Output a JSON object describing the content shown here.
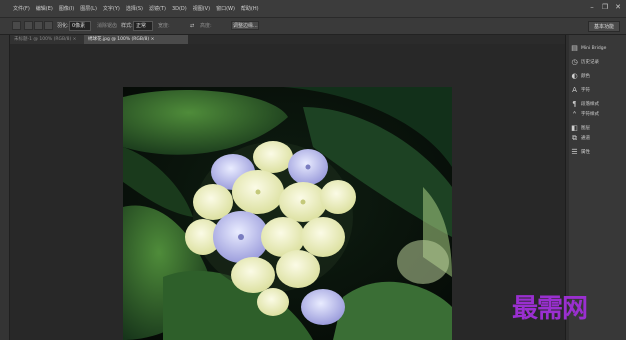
{
  "menu": {
    "items": [
      "文件(F)",
      "编辑(E)",
      "图像(I)",
      "图层(L)",
      "文字(Y)",
      "选择(S)",
      "滤镜(T)",
      "3D(D)",
      "视图(V)",
      "窗口(W)",
      "帮助(H)"
    ],
    "window_controls": [
      "minimize",
      "restore",
      "close"
    ]
  },
  "options": {
    "feather_label": "羽化:",
    "feather_value": "0像素",
    "antialias_label": "消除锯齿",
    "style_label": "样式:",
    "style_value": "正常",
    "width_label": "宽度:",
    "height_label": "高度:",
    "refine_edge_label": "调整边缘...",
    "essentials_label": "基本功能"
  },
  "tabs": [
    {
      "label": "未标题-1 @ 100% (RGB/8) ×"
    },
    {
      "label": "绣球花.jpg @ 100% (RGB/8) ×"
    }
  ],
  "panel": {
    "items": [
      {
        "icon": "mini-bridge-icon",
        "label": "Mini Bridge"
      },
      {
        "icon": "history-icon",
        "label": "历史记录"
      },
      {
        "icon": "color-icon",
        "label": "颜色"
      },
      {
        "icon": "character-icon",
        "label": "字符"
      },
      {
        "icon": "paragraph-icon",
        "label": "段落样式"
      },
      {
        "icon": "paths-icon",
        "label": "字符样式"
      },
      {
        "icon": "layers-icon",
        "label": "图层"
      },
      {
        "icon": "channels-icon",
        "label": "通道"
      },
      {
        "icon": "adjustments-icon",
        "label": "属性"
      }
    ]
  },
  "watermark": "最需网",
  "colors": {
    "workspace": "#282828",
    "panel": "#383838",
    "watermark": "#9a2fd0"
  }
}
